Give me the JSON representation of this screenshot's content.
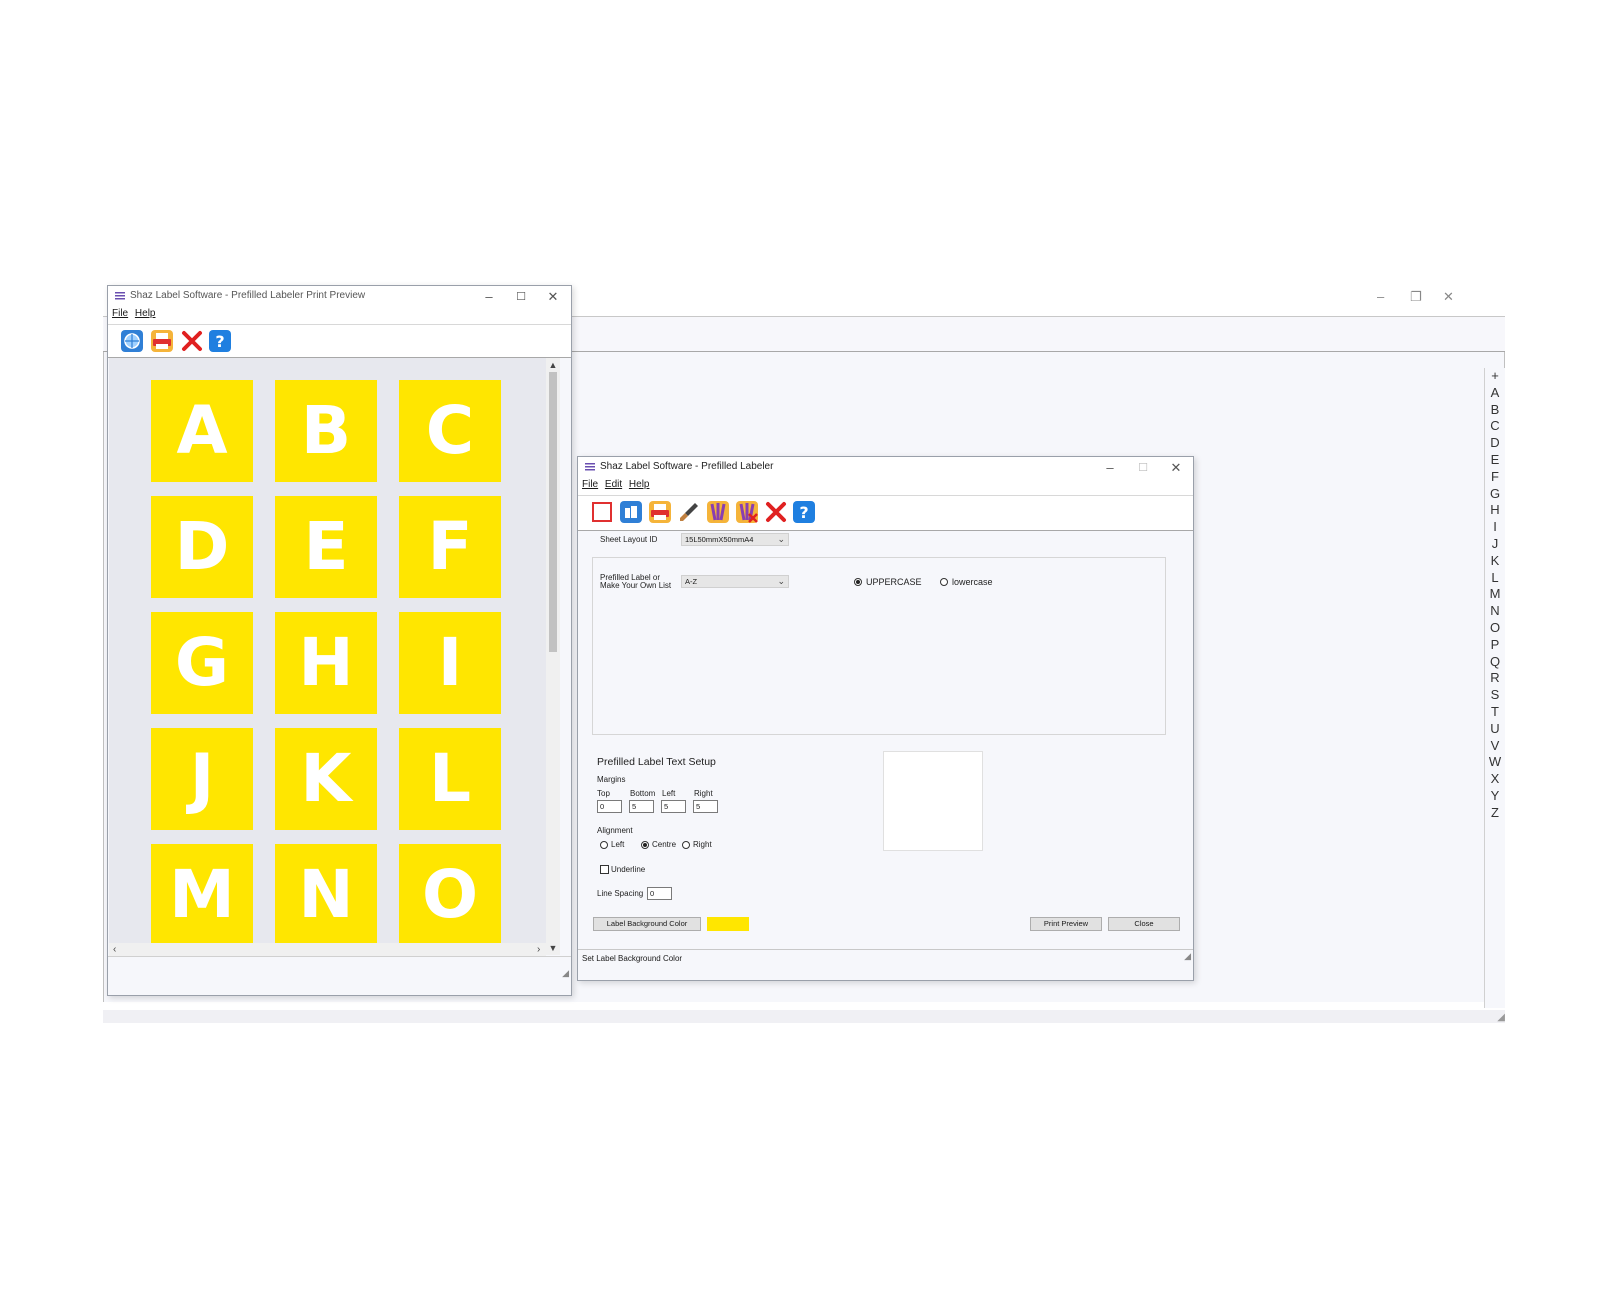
{
  "main_window": {
    "controls": [
      "–",
      "❐",
      "✕"
    ],
    "az_index": [
      "+",
      "A",
      "B",
      "C",
      "D",
      "E",
      "F",
      "G",
      "H",
      "I",
      "J",
      "K",
      "L",
      "M",
      "N",
      "O",
      "P",
      "Q",
      "R",
      "S",
      "T",
      "U",
      "V",
      "W",
      "X",
      "Y",
      "Z"
    ]
  },
  "preview_window": {
    "title": "Shaz Label Software - Prefilled Labeler Print Preview",
    "menu": [
      "File",
      "Help"
    ],
    "toolbar": [
      {
        "name": "globe-icon",
        "color": "#2f7fd6"
      },
      {
        "name": "print-icon",
        "color": "#f0a020"
      },
      {
        "name": "close-icon",
        "color": "#e02020"
      },
      {
        "name": "help-icon",
        "color": "#1f7fe0"
      }
    ],
    "labels": [
      "A",
      "B",
      "C",
      "D",
      "E",
      "F",
      "G",
      "H",
      "I",
      "J",
      "K",
      "L",
      "M",
      "N",
      "O"
    ],
    "label_color": "#ffe600"
  },
  "labeler_window": {
    "title": "Shaz Label Software - Prefilled Labeler",
    "menu": [
      "File",
      "Edit",
      "Help"
    ],
    "sheet_layout": {
      "label": "Sheet Layout ID",
      "value": "15L50mmX50mmA4"
    },
    "prefilled": {
      "label_line1": "Prefilled Label or",
      "label_line2": "Make Your Own List",
      "value": "A-Z"
    },
    "case": {
      "upper": "UPPERCASE",
      "lower": "lowercase",
      "selected": "upper"
    },
    "text_setup": {
      "heading": "Prefilled Label Text Setup",
      "margins_label": "Margins",
      "top_label": "Top",
      "top": "0",
      "bottom_label": "Bottom",
      "bottom": "5",
      "left_label": "Left",
      "left": "5",
      "right_label": "Right",
      "right": "5",
      "alignment_label": "Alignment",
      "align_left": "Left",
      "align_centre": "Centre",
      "align_right": "Right",
      "alignment_selected": "centre",
      "underline_label": "Underline",
      "underline_checked": false,
      "line_spacing_label": "Line Spacing",
      "line_spacing": "0"
    },
    "buttons": {
      "bg_color": "Label Background Color",
      "print_preview": "Print Preview",
      "close": "Close"
    },
    "bg_color_value": "#ffe600",
    "status": "Set Label Background Color"
  }
}
